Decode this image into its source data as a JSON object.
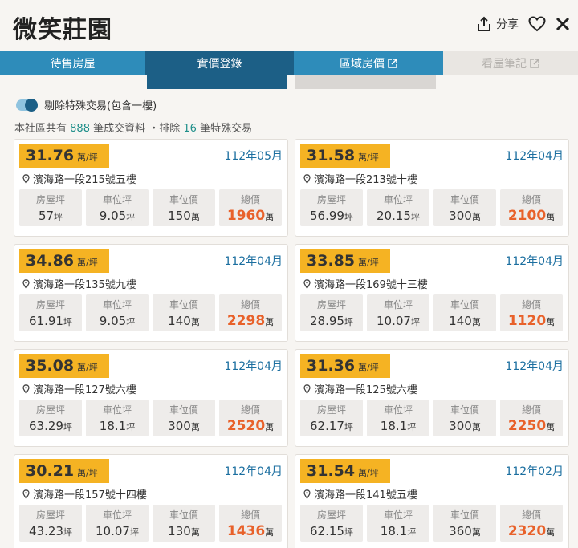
{
  "header": {
    "title": "微笑莊園",
    "share_label": "分享"
  },
  "tabs": [
    {
      "label": "待售房屋",
      "active": false
    },
    {
      "label": "實價登錄",
      "active": true
    },
    {
      "label": "區域房價",
      "active": false,
      "external": true
    },
    {
      "label": "看屋筆記",
      "active": false,
      "disabled": true,
      "external": true
    }
  ],
  "filter": {
    "label": "剔除特殊交易(包含一樓)",
    "enabled": true
  },
  "summary": {
    "prefix": "本社區共有",
    "total": "888",
    "mid": "筆成交資料 ・排除",
    "excluded": "16",
    "suffix": "筆特殊交易"
  },
  "labels": {
    "unit_per_ping": "萬/坪",
    "house_ping": "房屋坪",
    "parking_ping": "車位坪",
    "parking_price": "車位價",
    "total_price": "總價",
    "ping": "坪",
    "wan": "萬"
  },
  "colors": {
    "tab_blue": "#2e8cba",
    "tab_active": "#1c5f86",
    "badge": "#f5b323",
    "total_orange": "#e8612a",
    "date_blue": "#1c6fa0"
  },
  "records": [
    {
      "price": "31.76",
      "date": "112年05月",
      "address": "濱海路一段215號五樓",
      "house": "57",
      "parking_ping": "9.05",
      "parking_price": "150",
      "total": "1960"
    },
    {
      "price": "31.58",
      "date": "112年04月",
      "address": "濱海路一段213號十樓",
      "house": "56.99",
      "parking_ping": "20.15",
      "parking_price": "300",
      "total": "2100"
    },
    {
      "price": "34.86",
      "date": "112年04月",
      "address": "濱海路一段135號九樓",
      "house": "61.91",
      "parking_ping": "9.05",
      "parking_price": "140",
      "total": "2298"
    },
    {
      "price": "33.85",
      "date": "112年04月",
      "address": "濱海路一段169號十三樓",
      "house": "28.95",
      "parking_ping": "10.07",
      "parking_price": "140",
      "total": "1120"
    },
    {
      "price": "35.08",
      "date": "112年04月",
      "address": "濱海路一段127號六樓",
      "house": "63.29",
      "parking_ping": "18.1",
      "parking_price": "300",
      "total": "2520"
    },
    {
      "price": "31.36",
      "date": "112年04月",
      "address": "濱海路一段125號六樓",
      "house": "62.17",
      "parking_ping": "18.1",
      "parking_price": "300",
      "total": "2250"
    },
    {
      "price": "30.21",
      "date": "112年04月",
      "address": "濱海路一段157號十四樓",
      "house": "43.23",
      "parking_ping": "10.07",
      "parking_price": "130",
      "total": "1436"
    },
    {
      "price": "31.54",
      "date": "112年02月",
      "address": "濱海路一段141號五樓",
      "house": "62.15",
      "parking_ping": "18.1",
      "parking_price": "360",
      "total": "2320"
    }
  ]
}
